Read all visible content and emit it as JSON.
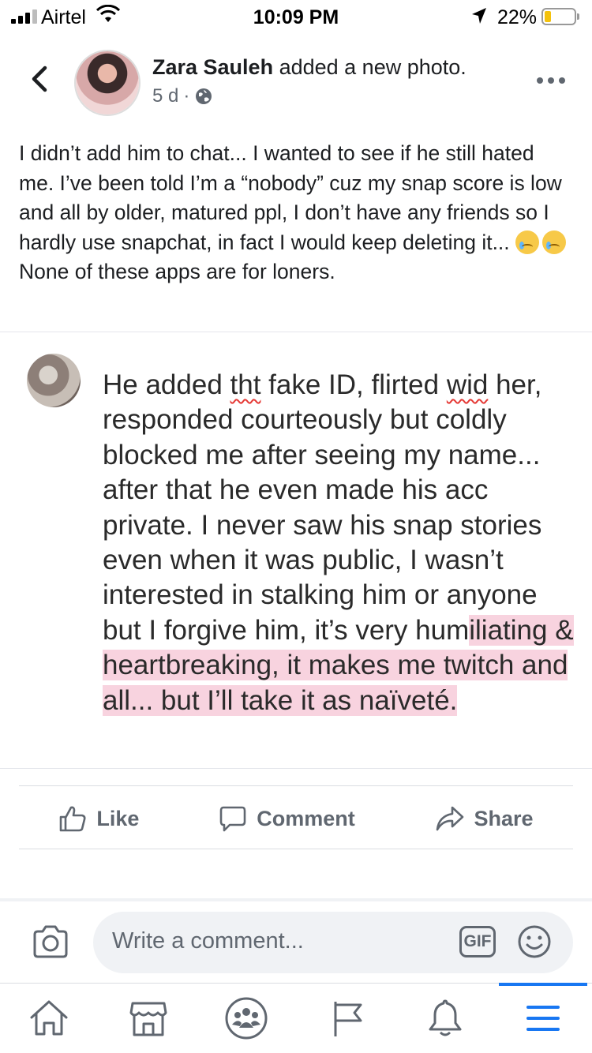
{
  "status": {
    "carrier": "Airtel",
    "time": "10:09 PM",
    "battery": "22%",
    "battery_level": 0.22
  },
  "post": {
    "author": "Zara Sauleh",
    "action": "added a new photo.",
    "time_ago": "5 d",
    "privacy_icon": "globe-icon",
    "text_part1": "I didn’t add him to chat... I wanted to see if he still hated me. I’ve been told I’m a “nobody” cuz my snap score is low and all by older, matured ppl, I don’t have any friends so I hardly use snapchat, in fact I would keep deleting it...",
    "text_part2": "None of these apps are for loners."
  },
  "photo": {
    "seg1": "He added ",
    "word1": "tht",
    "seg2": " fake ID, flirted ",
    "word2": "wid",
    "seg3": " her, responded courteously but coldly blocked me after seeing my name... after that he even made his acc private. I never saw his snap stories even when it was public, I wasn’t interested in stalking him or anyone but I forgive him, it’s very hum",
    "highlight": "iliating & heartbreaking, it makes me twitch and all... but I’ll take it as naïveté."
  },
  "actions": {
    "like": "Like",
    "comment": "Comment",
    "share": "Share"
  },
  "comment_bar": {
    "placeholder": "Write a comment...",
    "gif": "GIF"
  },
  "tabs": [
    "home",
    "marketplace",
    "groups",
    "pages",
    "notifications",
    "menu"
  ],
  "colors": {
    "accent": "#1877f2",
    "icon_gray": "#606770",
    "highlight": "#f8d3df",
    "battery": "#f4c20d"
  }
}
